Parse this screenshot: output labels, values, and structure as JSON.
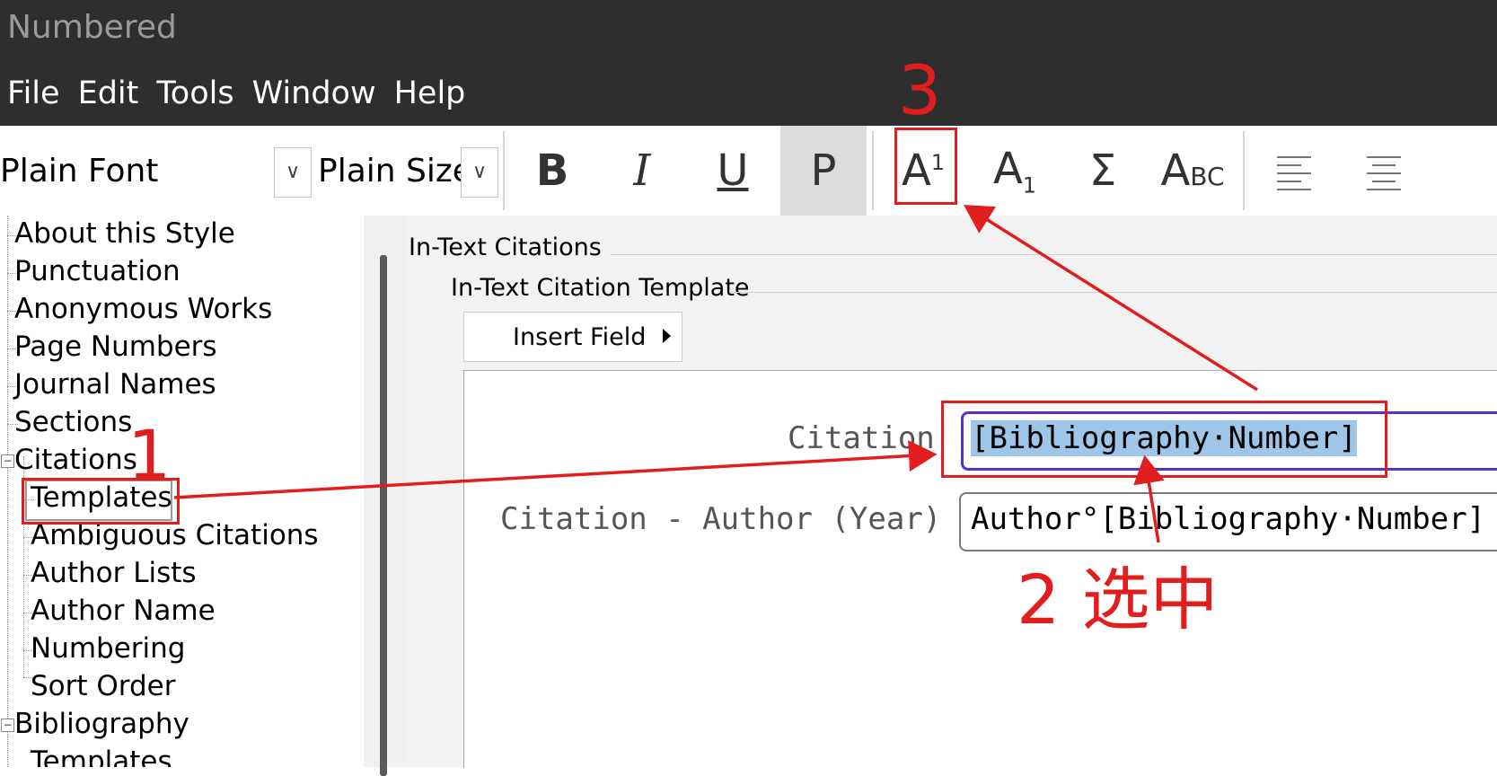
{
  "window": {
    "title": "Numbered"
  },
  "menu": [
    "File",
    "Edit",
    "Tools",
    "Window",
    "Help"
  ],
  "toolbar": {
    "font": "Plain Font",
    "size": "Plain Size",
    "bold": "B",
    "italic": "I",
    "underline": "U",
    "plain": "P",
    "superscript": "A",
    "superscript_mark": "1",
    "subscript": "A",
    "subscript_mark": "1",
    "symbol": "Σ",
    "smallcaps_big": "A",
    "smallcaps_small": "BC"
  },
  "tree": {
    "items": [
      "About this Style",
      "Punctuation",
      "Anonymous Works",
      "Page Numbers",
      "Journal Names",
      "Sections",
      "Citations"
    ],
    "citations_children": [
      "Templates",
      "Ambiguous Citations",
      "Author Lists",
      "Author Name",
      "Numbering",
      "Sort Order"
    ],
    "bibliography": "Bibliography",
    "bibliography_children": [
      "Templates"
    ]
  },
  "content": {
    "group_title": "In-Text Citations",
    "subgroup_title": "In-Text Citation Template",
    "insert_field": "Insert Field",
    "fields": [
      {
        "label": "Citation",
        "value": "[Bibliography·Number]"
      },
      {
        "label": "Citation - Author (Year)",
        "value": "Author°[Bibliography·Number]"
      }
    ]
  },
  "annotations": {
    "step1": "1",
    "step2": "2 选中",
    "step3": "3",
    "color": "#e11d1d"
  }
}
